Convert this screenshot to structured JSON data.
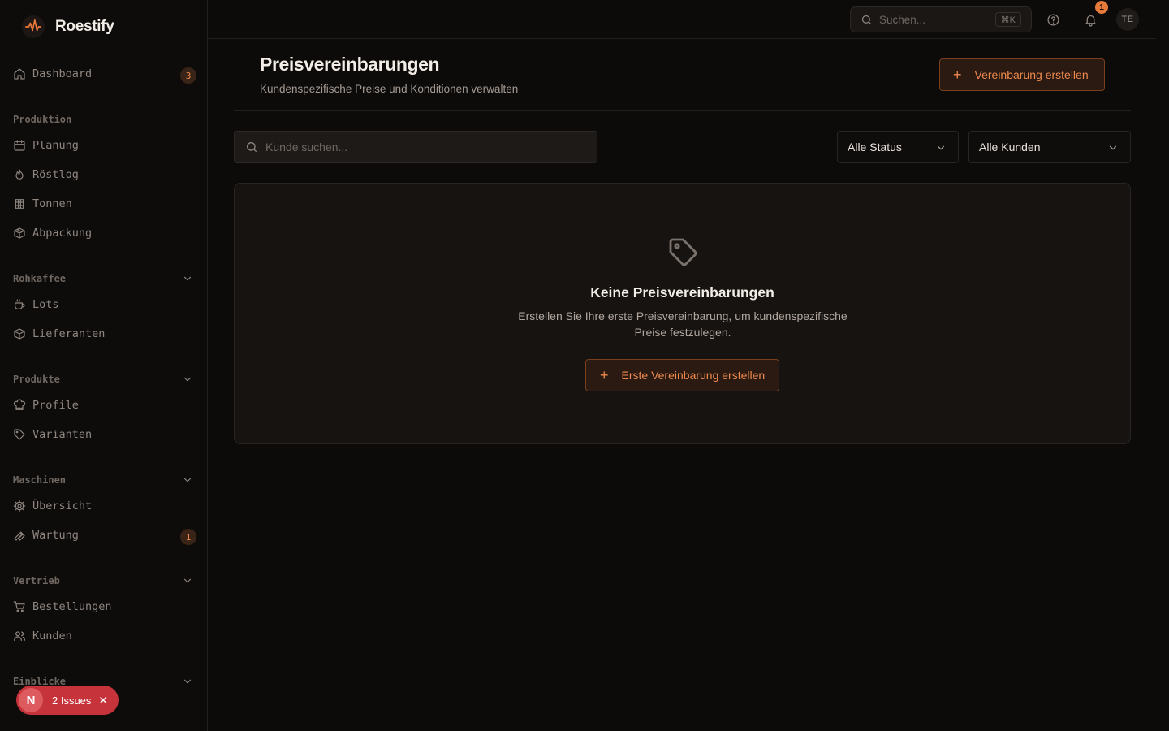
{
  "app": {
    "name": "Roestify"
  },
  "sidebar": {
    "dashboard": {
      "label": "Dashboard",
      "badge": "3"
    },
    "sections": [
      {
        "title": "Produktion",
        "items": [
          "Planung",
          "Röstlog",
          "Tonnen",
          "Abpackung"
        ]
      },
      {
        "title": "Rohkaffee",
        "items": [
          "Lots",
          "Lieferanten"
        ]
      },
      {
        "title": "Produkte",
        "items": [
          "Profile",
          "Varianten"
        ]
      },
      {
        "title": "Maschinen",
        "items": [
          "Übersicht",
          "Wartung"
        ],
        "wartung_badge": "1"
      },
      {
        "title": "Vertrieb",
        "items": [
          "Bestellungen",
          "Kunden"
        ]
      },
      {
        "title": "Einblicke",
        "items": []
      }
    ]
  },
  "issues": {
    "letter": "N",
    "label": "2 Issues",
    "close": "✕"
  },
  "topbar": {
    "search_placeholder": "Suchen...",
    "shortcut": "⌘K",
    "notification_count": "1",
    "avatar_initials": "TE"
  },
  "page": {
    "title": "Preisvereinbarungen",
    "subtitle": "Kundenspezifische Preise und Konditionen verwalten",
    "create_button": "Vereinbarung erstellen"
  },
  "filters": {
    "search_placeholder": "Kunde suchen...",
    "status_value": "Alle Status",
    "customer_value": "Alle Kunden"
  },
  "empty_state": {
    "title": "Keine Preisvereinbarungen",
    "description": "Erstellen Sie Ihre erste Preisvereinbarung, um kundenspezifische Preise festzulegen.",
    "button": "Erste Vereinbarung erstellen"
  },
  "colors": {
    "accent": "#ee8a4e",
    "background": "#0d0b0a",
    "issues": "#c7333b"
  }
}
